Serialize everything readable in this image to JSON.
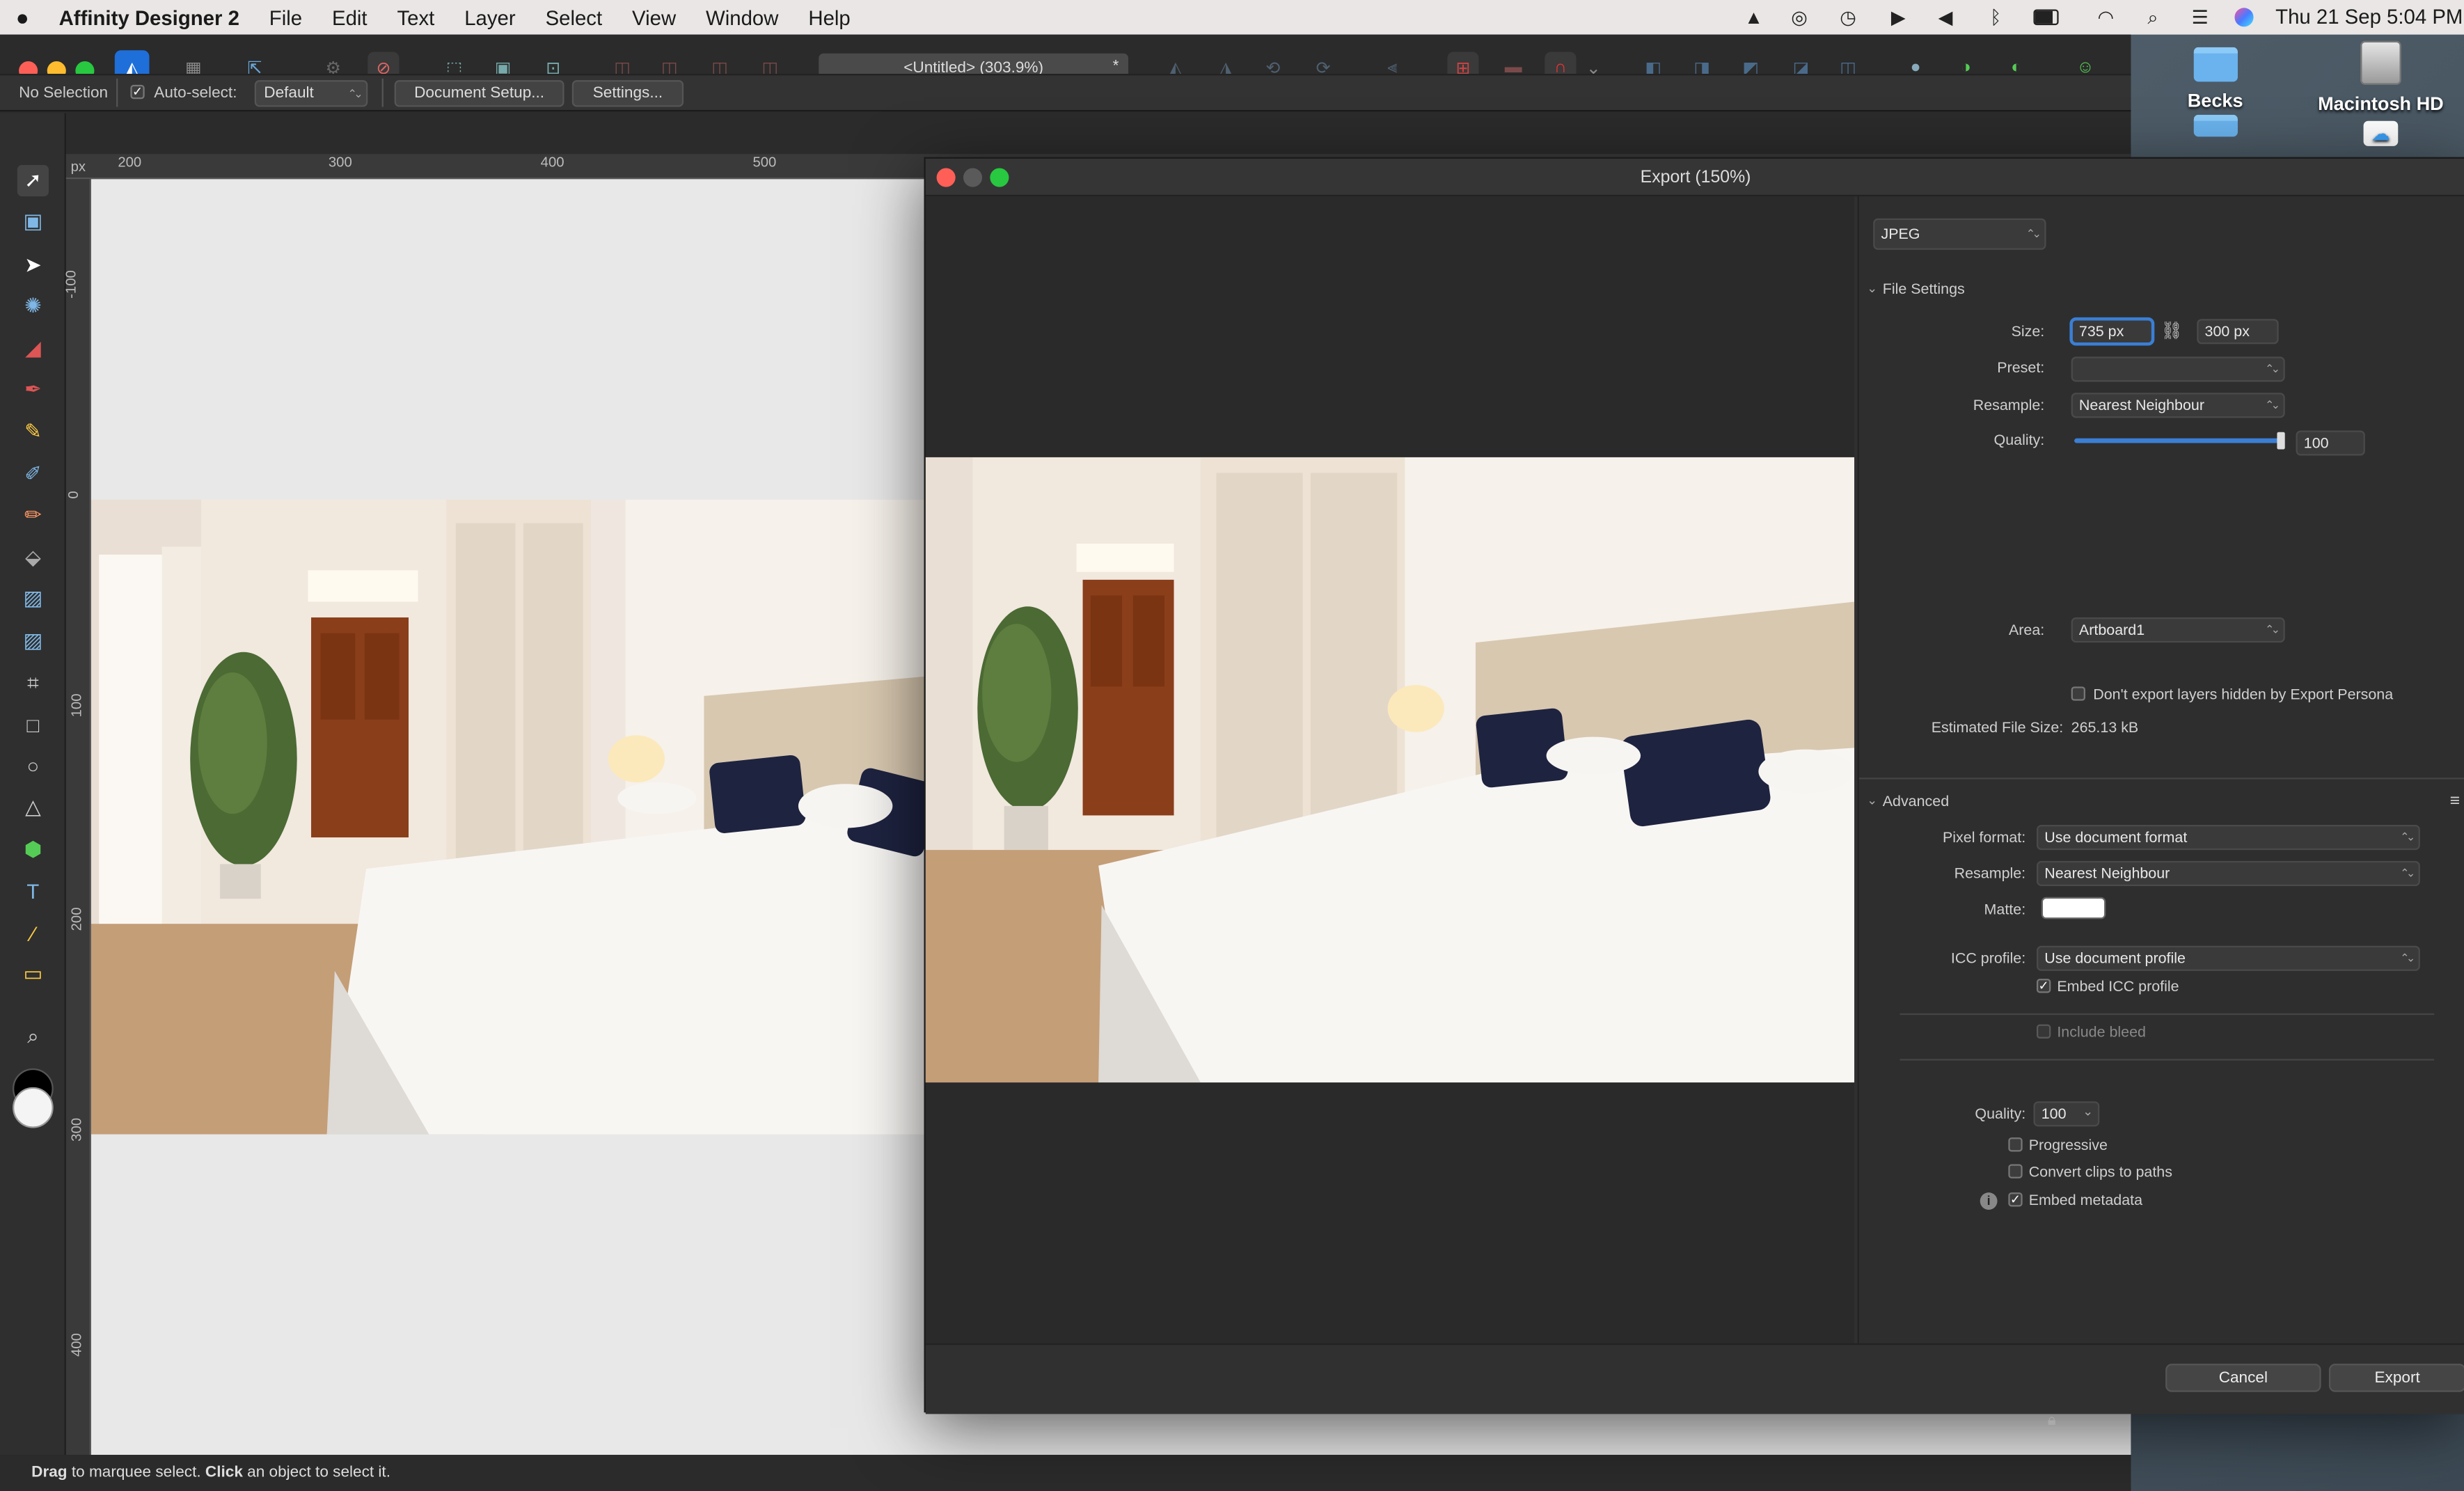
{
  "menubar": {
    "apple": "",
    "app_name": "Affinity Designer 2",
    "items": [
      "File",
      "Edit",
      "Text",
      "Layer",
      "Select",
      "View",
      "Window",
      "Help"
    ],
    "datetime": "Thu 21 Sep  5:04 PM",
    "status_icons": [
      "affinity-icon",
      "airdrop-icon",
      "time-machine-icon",
      "play-icon",
      "volume-icon",
      "bluetooth-icon",
      "battery-icon",
      "wifi-icon",
      "search-icon",
      "control-center-icon",
      "siri-icon"
    ]
  },
  "desktop": {
    "icons": [
      {
        "label": "Becks",
        "type": "folder"
      },
      {
        "label": "Macintosh HD",
        "type": "drive"
      }
    ]
  },
  "window": {
    "document_title": "<Untitled> (303.9%)",
    "title_suffix": "*"
  },
  "context_toolbar": {
    "selection": "No Selection",
    "auto_select_label": "Auto-select:",
    "auto_select_checked": true,
    "auto_select_mode": "Default",
    "document_setup": "Document Setup...",
    "settings": "Settings..."
  },
  "rulers": {
    "unit": "px",
    "horizontal_ticks": [
      "200",
      "300",
      "400",
      "500"
    ],
    "vertical_ticks": [
      "-100",
      "0",
      "100",
      "200",
      "300",
      "400"
    ]
  },
  "tools": [
    "move-tool",
    "artboard-tool",
    "node-tool",
    "corner-tool",
    "pencil-tool",
    "pen-tool",
    "brush-tool",
    "pixel-brush-tool",
    "paint-brush-tool",
    "fill-tool",
    "transparency-tool",
    "place-image-tool",
    "crop-tool",
    "rectangle-tool",
    "ellipse-tool",
    "triangle-tool",
    "shape-tool",
    "text-tool",
    "color-picker-tool",
    "measure-tool",
    "zoom-tool"
  ],
  "status_bar": {
    "drag_bold": "Drag",
    "drag_text": " to marquee select. ",
    "click_bold": "Click",
    "click_text": " an object to select it."
  },
  "export_dialog": {
    "title": "Export (150%)",
    "format": "JPEG",
    "file_settings": {
      "header": "File Settings",
      "size_label": "Size:",
      "width": "735 px",
      "height": "300 px",
      "preset_label": "Preset:",
      "preset": "",
      "resample_label": "Resample:",
      "resample": "Nearest Neighbour",
      "quality_label": "Quality:",
      "quality": "100",
      "quality_fraction": 1.0,
      "area_label": "Area:",
      "area": "Artboard1",
      "hidden_layers_label": "Don't export layers hidden by Export Persona",
      "hidden_layers_checked": false,
      "estimated_label": "Estimated File Size:",
      "estimated_size": "265.13 kB"
    },
    "advanced": {
      "header": "Advanced",
      "pixel_format_label": "Pixel format:",
      "pixel_format": "Use document format",
      "resample_label": "Resample:",
      "resample": "Nearest Neighbour",
      "matte_label": "Matte:",
      "matte_color": "#ffffff",
      "icc_label": "ICC profile:",
      "icc": "Use document profile",
      "embed_icc": "Embed ICC profile",
      "embed_icc_checked": true,
      "include_bleed": "Include bleed",
      "include_bleed_checked": false,
      "quality_label": "Quality:",
      "quality": "100",
      "progressive": "Progressive",
      "progressive_checked": false,
      "convert_clips": "Convert clips to paths",
      "convert_clips_checked": false,
      "embed_metadata": "Embed metadata",
      "embed_metadata_checked": true
    },
    "buttons": {
      "cancel": "Cancel",
      "export": "Export"
    }
  },
  "colors": {
    "accent": "#3a7fd5",
    "close_red": "#ff5f57",
    "minimize_yellow": "#febc2e",
    "zoom_green": "#28c840"
  }
}
